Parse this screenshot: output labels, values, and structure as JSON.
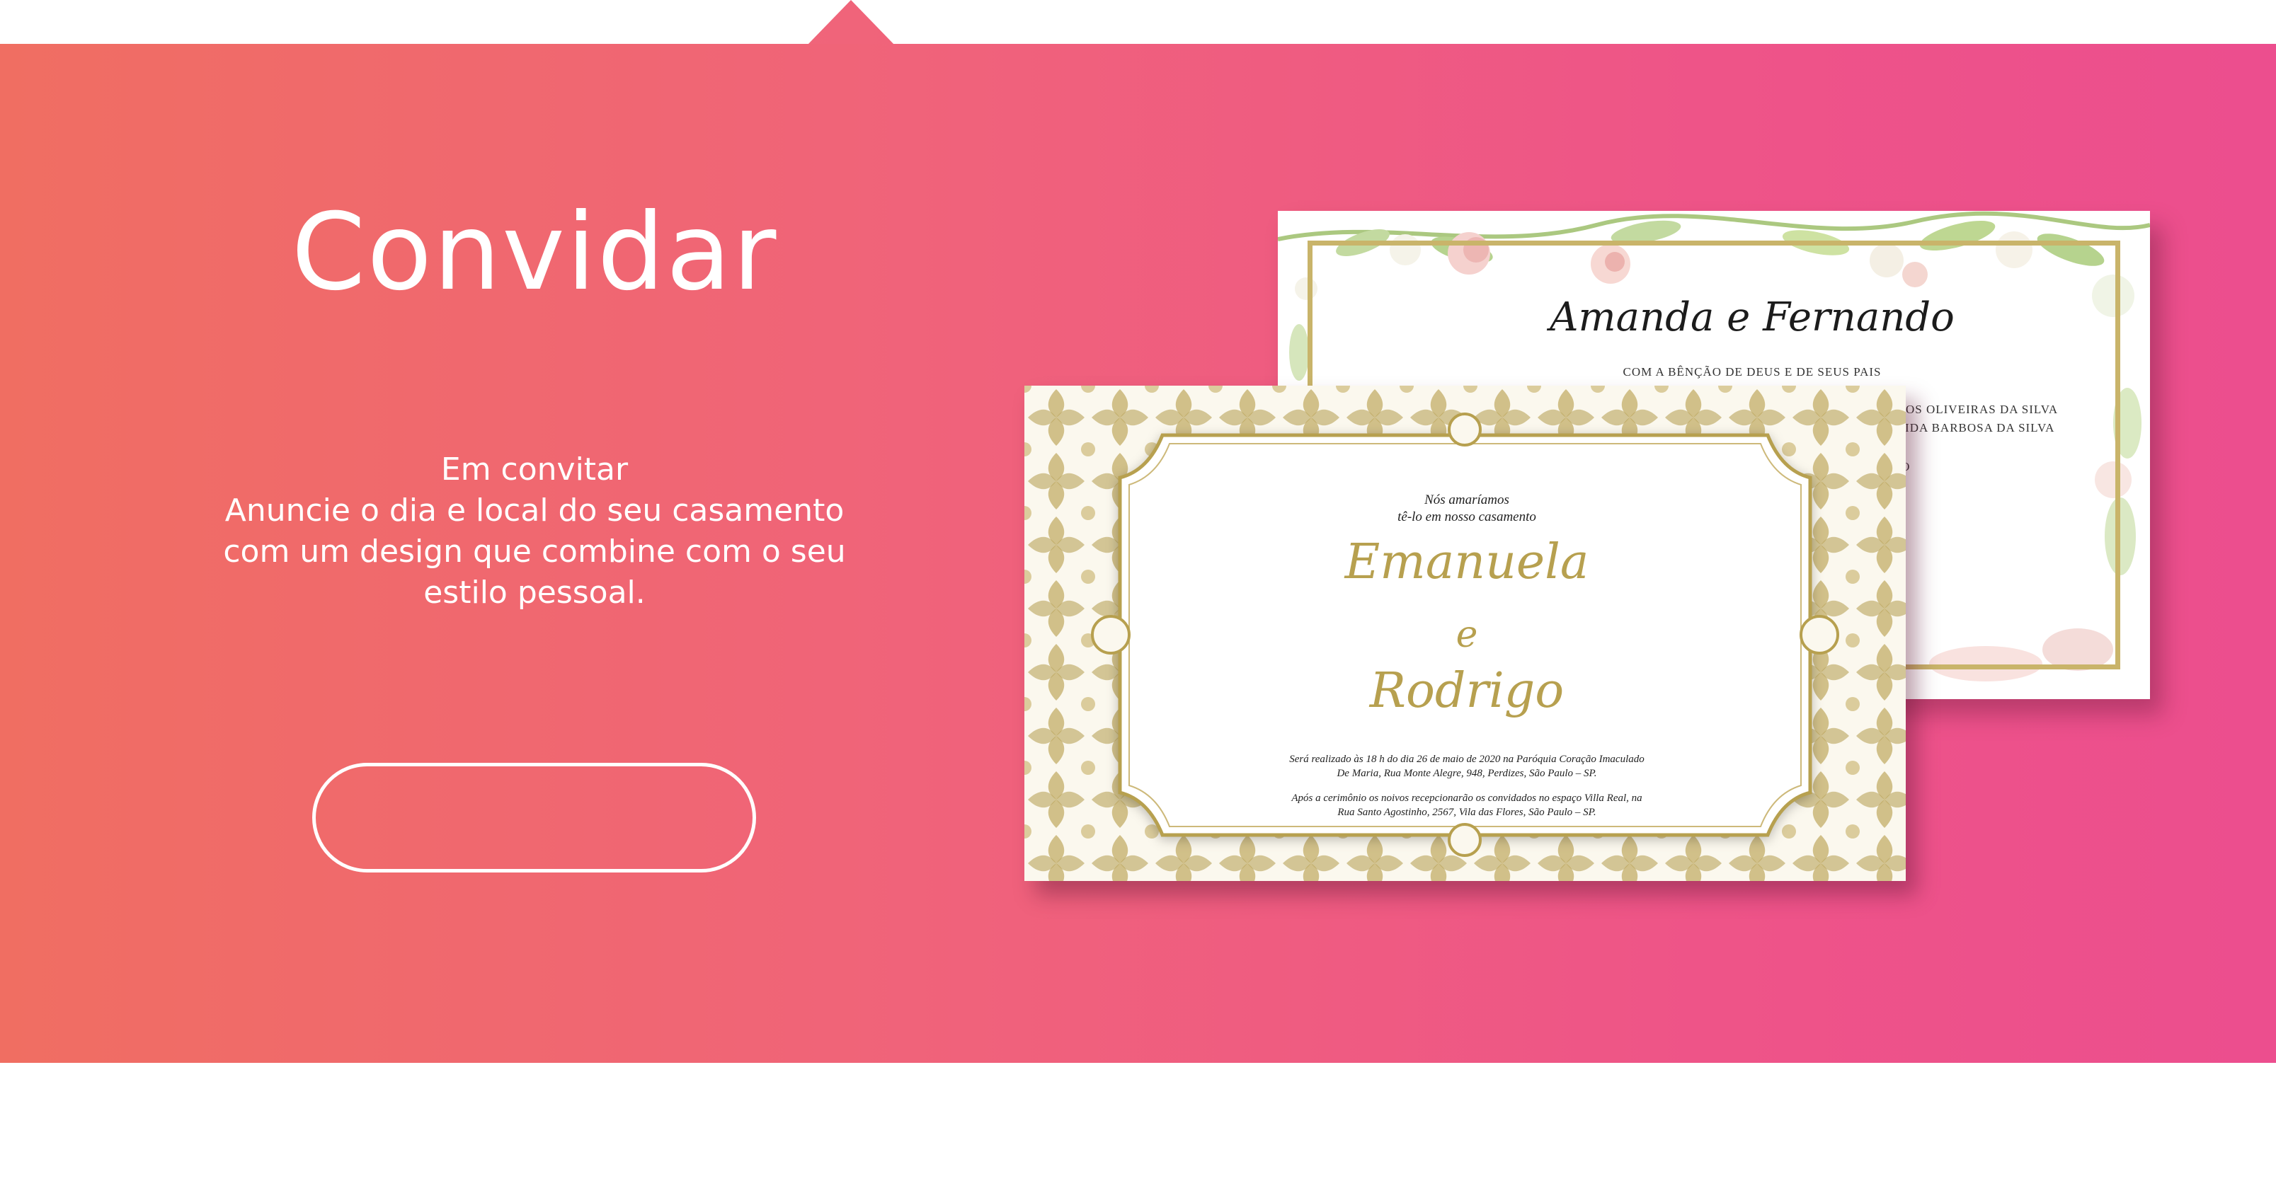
{
  "hero": {
    "title": "Convidar",
    "description_lines": [
      "Em convitar",
      "Anuncie o dia e local do seu casamento",
      "com um design que combine com o seu",
      "estilo pessoal."
    ],
    "cta_label": ""
  },
  "colors": {
    "gradient_start": "#f06e62",
    "gradient_end": "#ec4e8e",
    "gold": "#b7a04f",
    "text_on_banner": "#ffffff"
  },
  "back_card": {
    "names": "Amanda e Fernando",
    "blessing": "COM A BÊNÇÃO DE DEUS E DE SEUS PAIS",
    "parents_lines": [
      "ARLOS OLIVEIRAS DA SILVA",
      "RECIDA BARBOSA DA SILVA"
    ],
    "edge_text": "TO"
  },
  "front_card": {
    "intro_lines": [
      "Nós amaríamos",
      "tê-lo em nosso casamento"
    ],
    "name_1": "Emanuela",
    "conjunction": "e",
    "name_2": "Rodrigo",
    "details_1_lines": [
      "Será realizado às 18 h do dia 26 de maio de 2020 na Paróquia Coração Imaculado",
      "De Maria, Rua Monte Alegre, 948, Perdizes, São Paulo – SP."
    ],
    "details_2_lines": [
      "Após a cerimônio os noivos recepcionarão os convidados no espaço Villa Real, na",
      "Rua Santo Agostinho, 2567, Vila das Flores, São Paulo – SP."
    ]
  }
}
